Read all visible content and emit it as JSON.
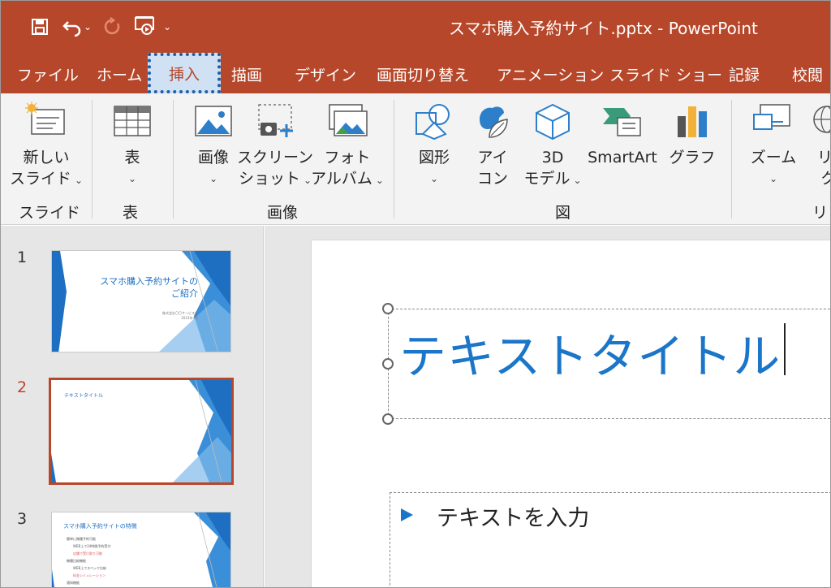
{
  "window": {
    "title": "スマホ購入予約サイト.pptx  -  PowerPoint"
  },
  "quick_access": {
    "save_icon": "save-icon",
    "undo_icon": "undo-icon",
    "redo_icon": "redo-icon",
    "present_icon": "present-from-start-icon",
    "customize_icon": "customize-qat-icon"
  },
  "tabs": [
    {
      "label": "ファイル"
    },
    {
      "label": "ホーム"
    },
    {
      "label": "挿入"
    },
    {
      "label": "描画"
    },
    {
      "label": "デザイン"
    },
    {
      "label": "画面切り替え"
    },
    {
      "label": "アニメーション"
    },
    {
      "label": "スライド ショー"
    },
    {
      "label": "記録"
    },
    {
      "label": "校閲"
    }
  ],
  "ribbon": {
    "slides": {
      "line1": "新しい",
      "line2": "スライド",
      "group": "スライド"
    },
    "table": {
      "line1": "表",
      "group": "表"
    },
    "image": {
      "line1": "画像"
    },
    "screenshot": {
      "line1": "スクリーン",
      "line2": "ショット"
    },
    "album": {
      "line1": "フォト",
      "line2": "アルバム"
    },
    "image_group": "画像",
    "shapes": {
      "line1": "図形"
    },
    "icons": {
      "line1": "アイ",
      "line2": "コン"
    },
    "model3d": {
      "line1": "3D",
      "line2": "モデル"
    },
    "smartart": {
      "line1": "SmartArt"
    },
    "chart": {
      "line1": "グラフ"
    },
    "figure_group": "図",
    "zoom": {
      "line1": "ズーム"
    },
    "link": {
      "line1": "リ",
      "line2": "ク"
    },
    "link_group": "リン"
  },
  "thumbnails": [
    {
      "number": "1",
      "title_line1": "スマホ購入予約サイトの",
      "title_line2": "ご紹介",
      "sub_line1": "株式会社〇〇サービス部",
      "sub_line2": "2023年4月"
    },
    {
      "number": "2",
      "title": "テキストタイトル"
    },
    {
      "number": "3",
      "title": "スマホ購入予約サイトの特徴",
      "lines": [
        "簡単に機種予約可能",
        "WEB上で24時間予約受付",
        "店舗で受け取り可能",
        "機種比較機能",
        "WEB上でスペック比較",
        "料金シミュレーション",
        "通知機能"
      ]
    }
  ],
  "slide": {
    "title": "テキストタイトル",
    "body": "テキストを入力"
  },
  "colors": {
    "accent": "#b7472a",
    "title_blue": "#1b76c9"
  }
}
